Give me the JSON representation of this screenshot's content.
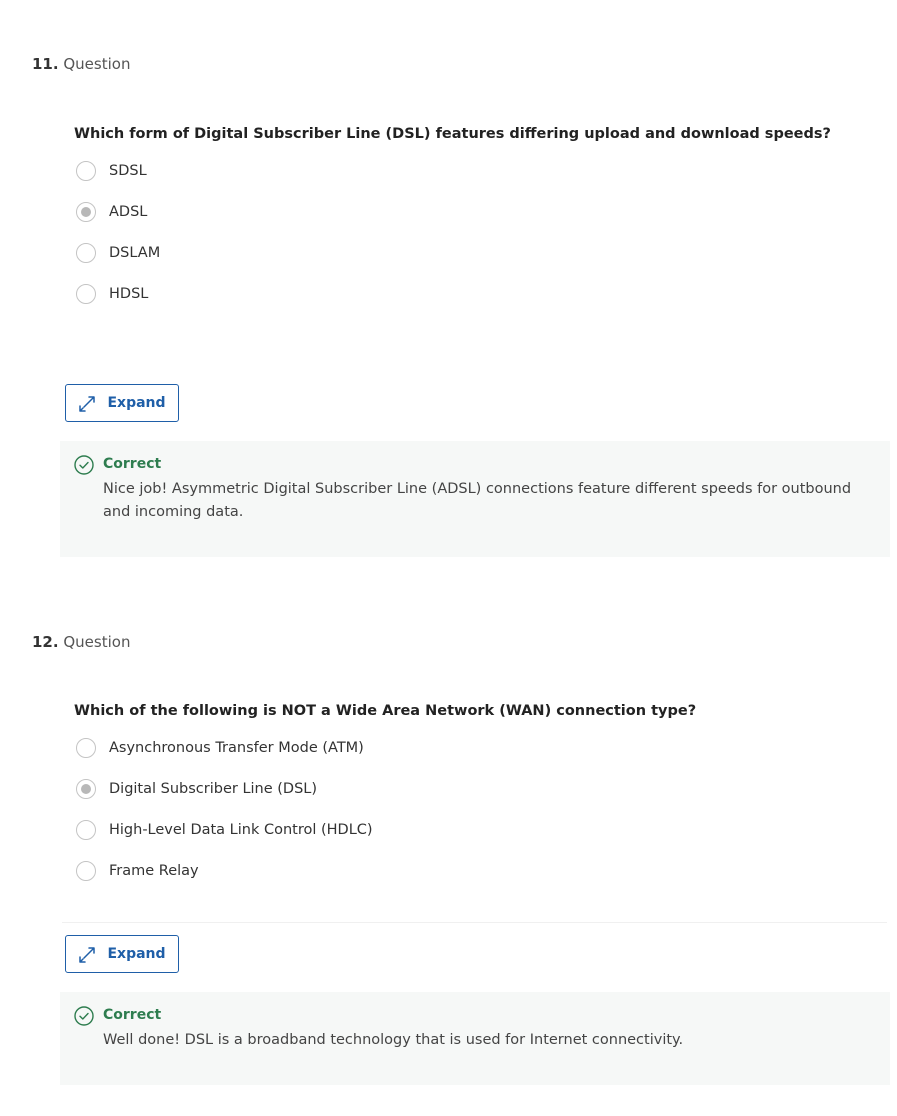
{
  "questions": [
    {
      "number": "11.",
      "heading": "Question",
      "text": "Which form of Digital Subscriber Line (DSL) features differing upload and download speeds?",
      "options": [
        {
          "label": "SDSL",
          "selected": false
        },
        {
          "label": "ADSL",
          "selected": true
        },
        {
          "label": "DSLAM",
          "selected": false
        },
        {
          "label": "HDSL",
          "selected": false
        }
      ],
      "expand_label": "Expand",
      "feedback": {
        "status": "Correct",
        "message": "Nice job! Asymmetric Digital Subscriber Line (ADSL) connections feature different speeds for outbound and incoming data."
      }
    },
    {
      "number": "12.",
      "heading": "Question",
      "text": "Which of the following is NOT a Wide Area Network (WAN) connection type?",
      "options": [
        {
          "label": "Asynchronous Transfer Mode (ATM)",
          "selected": false
        },
        {
          "label": "Digital Subscriber Line (DSL)",
          "selected": true
        },
        {
          "label": "High-Level Data Link Control (HDLC)",
          "selected": false
        },
        {
          "label": "Frame Relay",
          "selected": false
        }
      ],
      "expand_label": "Expand",
      "feedback": {
        "status": "Correct",
        "message": "Well done! DSL is a broadband technology that is used for Internet connectivity."
      }
    }
  ],
  "colors": {
    "accent": "#1f5fa8",
    "correct": "#2e7d4f",
    "feedback_bg": "#f6f8f7",
    "radio_border": "#c4c4c4",
    "radio_fill": "#b8b8b8"
  },
  "icons": {
    "expand": "expand-arrows-icon",
    "correct": "check-circle-icon"
  }
}
